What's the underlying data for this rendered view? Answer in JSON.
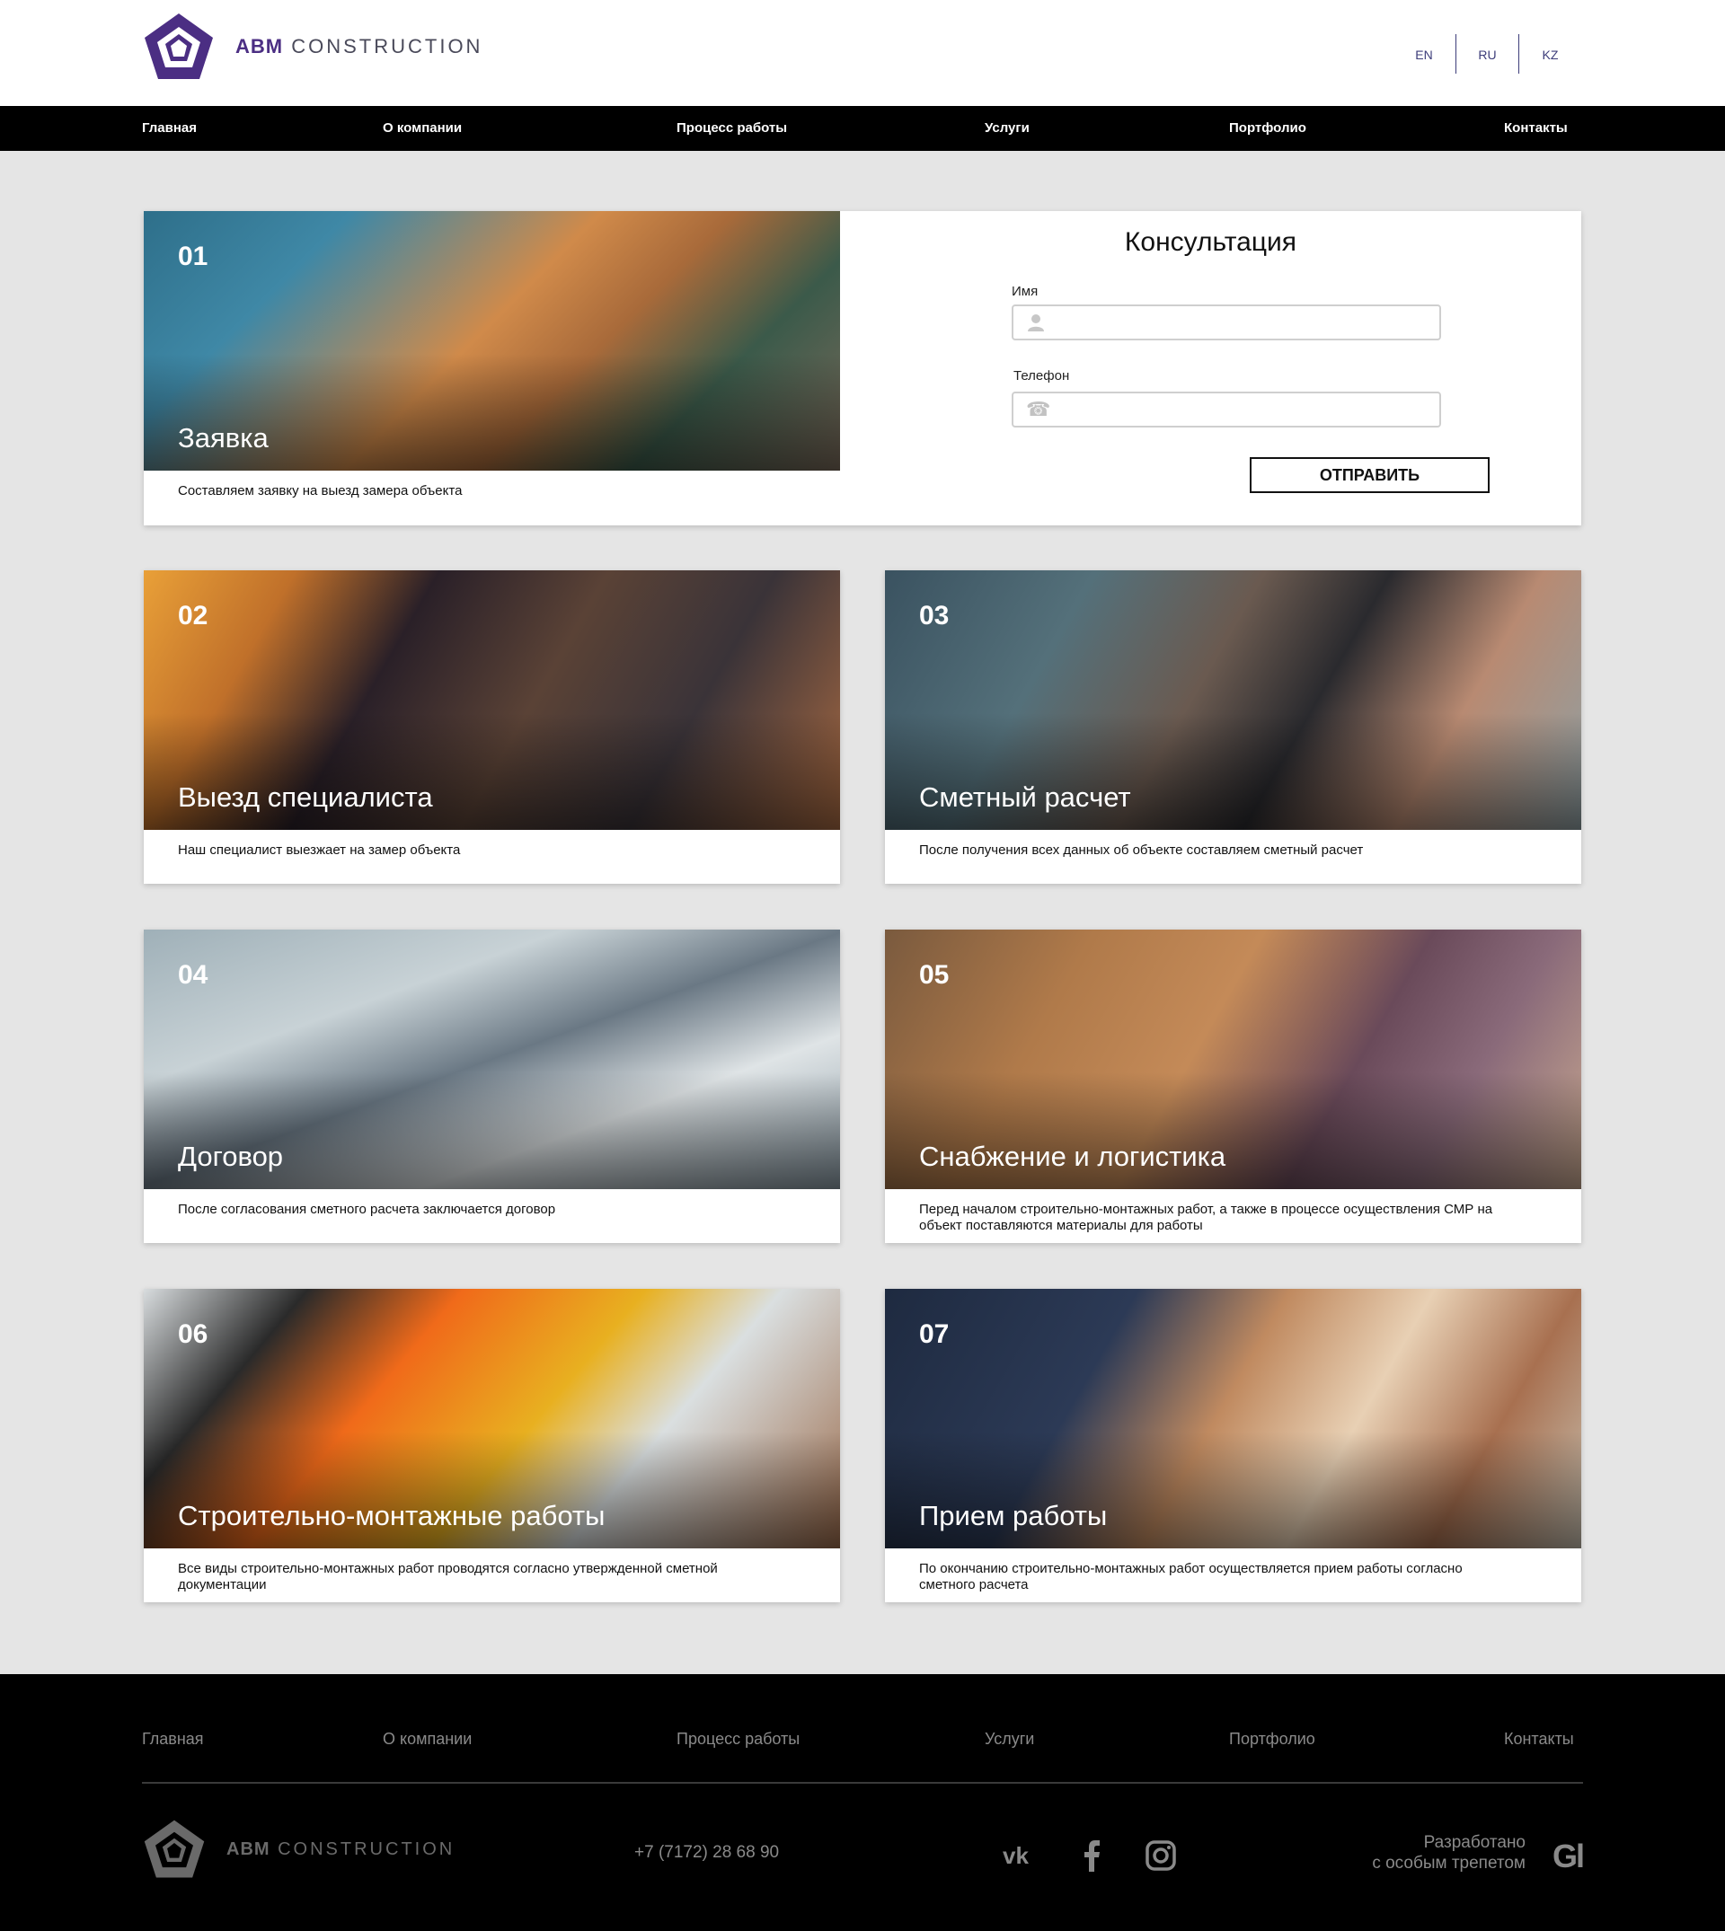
{
  "brand": {
    "strong": "ABM",
    "light": "CONSTRUCTION",
    "color": "#4b2e83"
  },
  "langs": [
    "EN",
    "RU",
    "KZ"
  ],
  "nav": [
    "Главная",
    "О компании",
    "Процесс работы",
    "Услуги",
    "Портфолио",
    "Контакты"
  ],
  "form": {
    "title": "Консультация",
    "name_label": "Имя",
    "phone_label": "Телефон",
    "submit_label": "ОТПРАВИТЬ",
    "name_icon": "user-icon",
    "phone_icon": "phone-icon"
  },
  "steps": [
    {
      "num": "01",
      "title": "Заявка",
      "desc": "Составляем заявку на выезд замера объекта"
    },
    {
      "num": "02",
      "title": "Выезд специалиста",
      "desc": "Наш специалист выезжает на замер объекта"
    },
    {
      "num": "03",
      "title": "Сметный расчет",
      "desc": "После получения всех данных об объекте составляем сметный расчет"
    },
    {
      "num": "04",
      "title": "Договор",
      "desc": "После согласования сметного расчета заключается договор"
    },
    {
      "num": "05",
      "title": "Снабжение и логистика",
      "desc": "Перед началом строительно-монтажных работ, а также в процессе осуществления СМР на объект поставляются материалы для работы"
    },
    {
      "num": "06",
      "title": "Строительно-монтажные работы",
      "desc": "Все виды строительно-монтажных работ проводятся согласно утвержденной сметной документации"
    },
    {
      "num": "07",
      "title": "Прием работы",
      "desc": "По окончанию строительно-монтажных работ осуществляется прием работы согласно сметного расчета"
    }
  ],
  "footer": {
    "nav": [
      "Главная",
      "О компании",
      "Процесс работы",
      "Услуги",
      "Портфолио",
      "Контакты"
    ],
    "phone": "+7 (7172) 28 68 90",
    "social": [
      "vk-icon",
      "facebook-icon",
      "instagram-icon"
    ],
    "dev_line1": "Разработано",
    "dev_line2": "с особым трепетом",
    "dev_logo": "Gl"
  }
}
